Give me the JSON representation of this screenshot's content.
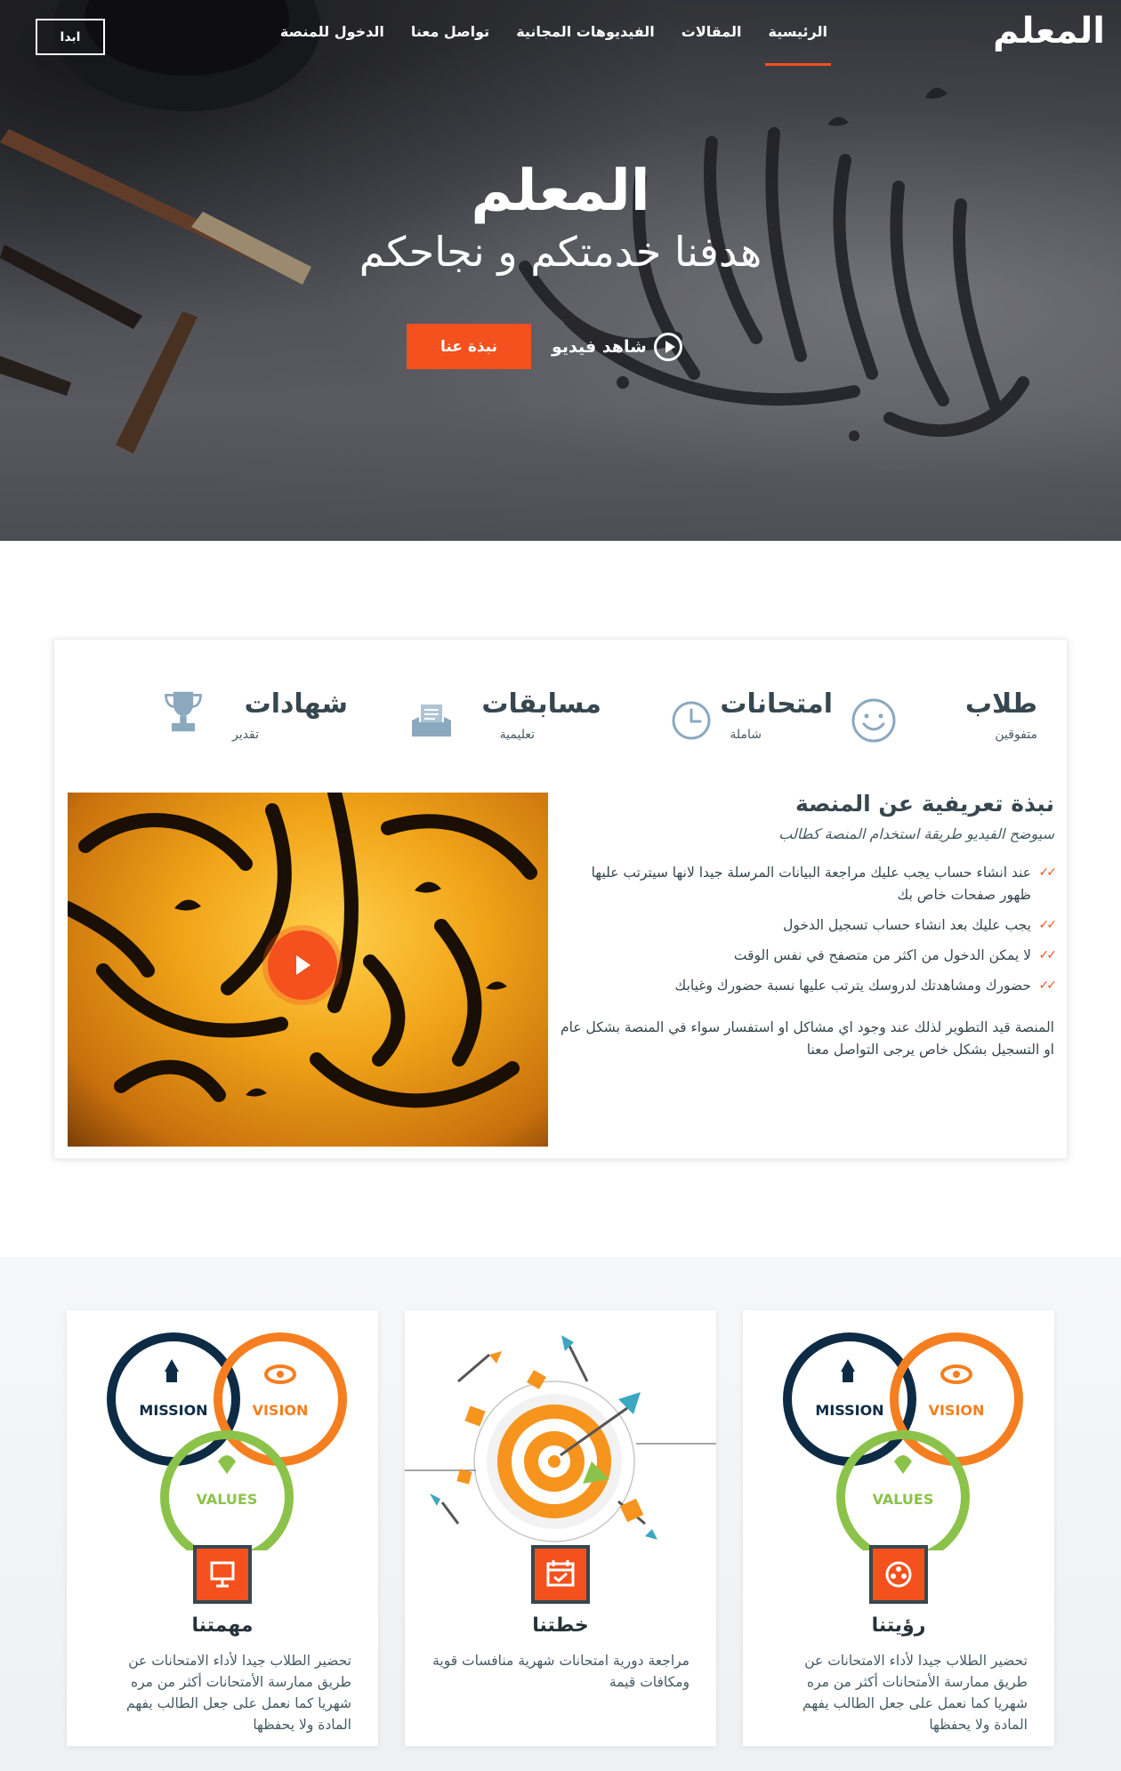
{
  "nav": {
    "brand": "المعلم",
    "items": [
      "الرئيسية",
      "المقالات",
      "الفيديوهات المجانية",
      "تواصل معنا",
      "الدخول للمنصة"
    ],
    "active_item": "الرئيسية",
    "start_button": "ابدا"
  },
  "hero": {
    "title": "المعلم",
    "subtitle": "هدفنا خدمتكم و نجاحكم",
    "about_button": "نبذة عنا",
    "watch_label": "شاهد فيديو"
  },
  "features": [
    {
      "title": "طلاب",
      "subtitle": "متفوقين",
      "icon": "smile-icon"
    },
    {
      "title": "امتحانات",
      "subtitle": "شاملة",
      "icon": "clock-icon"
    },
    {
      "title": "مسابقات",
      "subtitle": "تعليمية",
      "icon": "tray-icon"
    },
    {
      "title": "شهادات",
      "subtitle": "تقدير",
      "icon": "trophy-icon"
    }
  ],
  "intro": {
    "title": "نبذة تعريفية عن المنصة",
    "subtitle": "سيوضح الفيديو طريقة استخدام المنصة كطالب",
    "points": [
      "عند انشاء حساب يجب عليك مراجعة البيانات المرسلة جيدا لانها سيترتب عليها ظهور صفحات خاص بك",
      "يجب عليك بعد انشاء حساب تسجيل الدخول",
      "لا يمكن الدخول من اكثر من متصفح في نفس الوقت",
      "حضورك ومشاهدتك لدروسك يترتب عليها نسبة حضورك وغيابك"
    ],
    "note": "المنصة قيد التطوير لذلك عند وجود اي مشاكل او استفسار سواء في المنصة بشكل عام او التسجيل بشكل خاص يرجى التواصل معنا"
  },
  "diagram_labels": {
    "mission": "MISSION",
    "vision": "VISION",
    "values": "VALUES"
  },
  "cards": [
    {
      "title": "رؤيتنا",
      "text": "تحضير الطلاب جيدا لأداء الامتحانات عن طريق ممارسة الأمتحانات أكثر من مره شهريا كما نعمل على جعل الطالب يفهم المادة ولا يحفظها",
      "icon": "film-reel-icon"
    },
    {
      "title": "خطتنا",
      "text": "مراجعة دورية امتحانات شهرية منافسات قوية ومكافات قيمة",
      "icon": "calendar-icon"
    },
    {
      "title": "مهمتنا",
      "text": "تحضير الطلاب جيدا لأداء الامتحانات عن طريق ممارسة الأمتحانات أكثر من مره شهريا كما نعمل على جعل الطالب يفهم المادة ولا يحفظها",
      "icon": "easel-icon"
    }
  ],
  "colors": {
    "accent": "#f4511e",
    "dark": "#37474f",
    "navy": "#0d2b45",
    "orange": "#f57f20",
    "green": "#8bc34a"
  }
}
